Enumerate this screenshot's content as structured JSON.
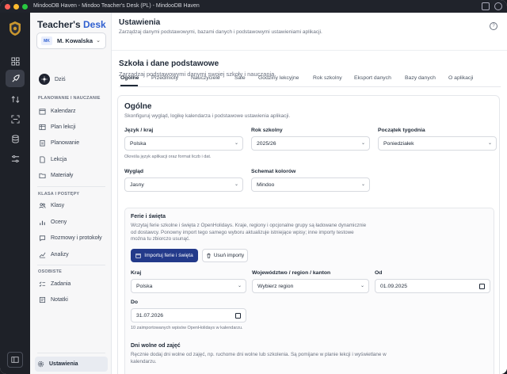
{
  "window": {
    "title": "MindooDB Haven - Mindoo Teacher's Desk (PL) - MindooDB Haven"
  },
  "sidebar": {
    "brand_prefix": "Teacher's ",
    "brand_accent": "Desk",
    "user_initials": "MK",
    "user_name": "M. Kowalska",
    "today_label": "Dziś",
    "section_planning": "PLANOWANIE I NAUCZANIE",
    "section_class": "KLASA I POSTĘPY",
    "section_personal": "OSOBISTE",
    "items": [
      {
        "label": "Kalendarz"
      },
      {
        "label": "Plan lekcji"
      },
      {
        "label": "Planowanie"
      },
      {
        "label": "Lekcja"
      },
      {
        "label": "Materiały"
      },
      {
        "label": "Klasy"
      },
      {
        "label": "Oceny"
      },
      {
        "label": "Rozmowy i protokoły"
      },
      {
        "label": "Analizy"
      },
      {
        "label": "Zadania"
      },
      {
        "label": "Notatki"
      }
    ],
    "settings_label": "Ustawienia"
  },
  "header": {
    "title": "Ustawienia",
    "subtitle": "Zarządzaj danymi podstawowymi, bazami danych i podstawowymi ustawieniami aplikacji."
  },
  "section": {
    "title": "Szkoła i dane podstawowe",
    "subtitle": "Zarządzaj podstawowymi danymi swojej szkoły i nauczania."
  },
  "tabs": [
    {
      "label": "Ogólne"
    },
    {
      "label": "Przedmioty"
    },
    {
      "label": "Nauczyciele"
    },
    {
      "label": "Sale"
    },
    {
      "label": "Godziny lekcyjne"
    },
    {
      "label": "Rok szkolny"
    },
    {
      "label": "Eksport danych"
    },
    {
      "label": "Bazy danych"
    },
    {
      "label": "O aplikacji"
    }
  ],
  "general": {
    "title": "Ogólne",
    "subtitle": "Skonfiguruj wygląd, logikę kalendarza i podstawowe ustawienia aplikacji.",
    "language_label": "Język / kraj",
    "language_value": "Polska",
    "language_hint": "Określa język aplikacji oraz format liczb i dat.",
    "school_year_label": "Rok szkolny",
    "school_year_value": "2025/26",
    "week_start_label": "Początek tygodnia",
    "week_start_value": "Poniedziałek",
    "appearance_label": "Wygląd",
    "appearance_value": "Jasny",
    "color_scheme_label": "Schemat kolorów",
    "color_scheme_value": "Mindoo"
  },
  "holidays": {
    "title": "Ferie i święta",
    "description": "Wczytaj ferie szkolne i święta z OpenHolidays. Kraje, regiony i opcjonalne grupy są ładowane dynamicznie od dostawcy. Ponowny import tego samego wyboru aktualizuje istniejące wpisy; inne importy testowe można tu zbiorczo usunąć.",
    "import_button": "Importuj ferie i święta",
    "delete_button": "Usuń importy",
    "country_label": "Kraj",
    "country_value": "Polska",
    "region_label": "Województwo / region / kanton",
    "region_value": "Wybierz region",
    "from_label": "Od",
    "from_value": "01.09.2025",
    "to_label": "Do",
    "to_value": "31.07.2026",
    "imported_hint": "10 zaimportowanych wpisów OpenHolidays w kalendarzu.",
    "free_days_title": "Dni wolne od zajęć",
    "free_days_desc": "Ręcznie dodaj dni wolne od zajęć, np. ruchome dni wolne lub szkolenia. Są pomijane w planie lekcji i wyświetlane w kalendarzu."
  },
  "colors": {
    "accent": "#2f5fd0",
    "primary_button": "#233a8a"
  }
}
